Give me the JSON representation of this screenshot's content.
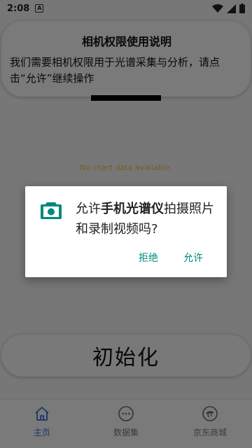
{
  "status_bar": {
    "time": "2:08",
    "notification_letter": "A"
  },
  "info_card": {
    "title": "相机权限使用说明",
    "body": "我们需要相机权限用于光谱采集与分析，请点击“允许”继续操作"
  },
  "chart": {
    "empty_text": "No chart data available."
  },
  "init_button": {
    "label": "初始化"
  },
  "bottom_nav": {
    "items": [
      {
        "label": "主页",
        "icon": "home-icon",
        "active": true
      },
      {
        "label": "数据集",
        "icon": "more-dots-icon",
        "active": false
      },
      {
        "label": "京东商城",
        "icon": "jd-logo-icon",
        "active": false
      }
    ]
  },
  "dialog": {
    "icon": "camera-icon",
    "message_prefix": "允许",
    "app_name": "手机光谱仪",
    "message_suffix": "拍摄照片和录制视频吗?",
    "deny_label": "拒绝",
    "allow_label": "允许",
    "accent_color": "#00897b"
  },
  "colors": {
    "nav_active": "#2a6fd0",
    "empty_text": "#e7b84a"
  }
}
